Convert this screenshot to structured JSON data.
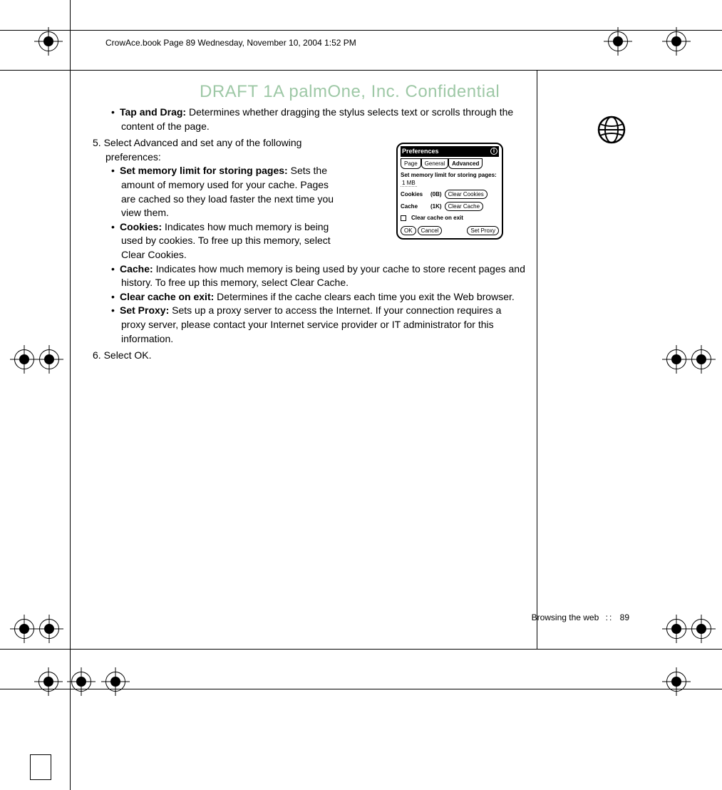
{
  "header": {
    "text": "CrowAce.book  Page 89  Wednesday, November 10, 2004  1:52 PM"
  },
  "watermark": "DRAFT 1A  palmOne, Inc.   Confidential",
  "body": {
    "tap_drag": {
      "label": "Tap and Drag:",
      "text": " Determines whether dragging the stylus selects text or scrolls through the content of the page."
    },
    "step5": "5. Select Advanced and set any of the following preferences:",
    "mem": {
      "label": "Set memory limit for storing pages:",
      "text": " Sets the amount of memory used for your cache. Pages are cached so they load faster the next time you view them."
    },
    "cookies": {
      "label": "Cookies:",
      "text": " Indicates how much memory is being used by cookies. To free up this memory, select Clear Cookies."
    },
    "cache": {
      "label": "Cache:",
      "text": " Indicates how much memory is being used by your cache to store recent pages and history. To free up this memory, select Clear Cache."
    },
    "clear": {
      "label": "Clear cache on exit:",
      "text": " Determines if the cache clears each time you exit the Web browser."
    },
    "proxy": {
      "label": "Set Proxy:",
      "text": " Sets up a proxy server to access the Internet. If your connection requires a proxy server, please contact your Internet service provider or IT administrator for this information."
    },
    "step6": "6. Select OK."
  },
  "prefs": {
    "title": "Preferences",
    "tabs": {
      "page": "Page",
      "general": "General",
      "advanced": "Advanced"
    },
    "mem_label": "Set memory limit for storing pages:",
    "mem_value": "1 MB",
    "cookies_label": "Cookies",
    "cookies_size": "(0B)",
    "clear_cookies": "Clear Cookies",
    "cache_label": "Cache",
    "cache_size": "(1K)",
    "clear_cache": "Clear Cache",
    "clear_on_exit": "Clear cache on exit",
    "ok": "OK",
    "cancel": "Cancel",
    "set_proxy": "Set Proxy"
  },
  "footer": {
    "section": "Browsing the web",
    "sep": "::",
    "page": "89"
  }
}
